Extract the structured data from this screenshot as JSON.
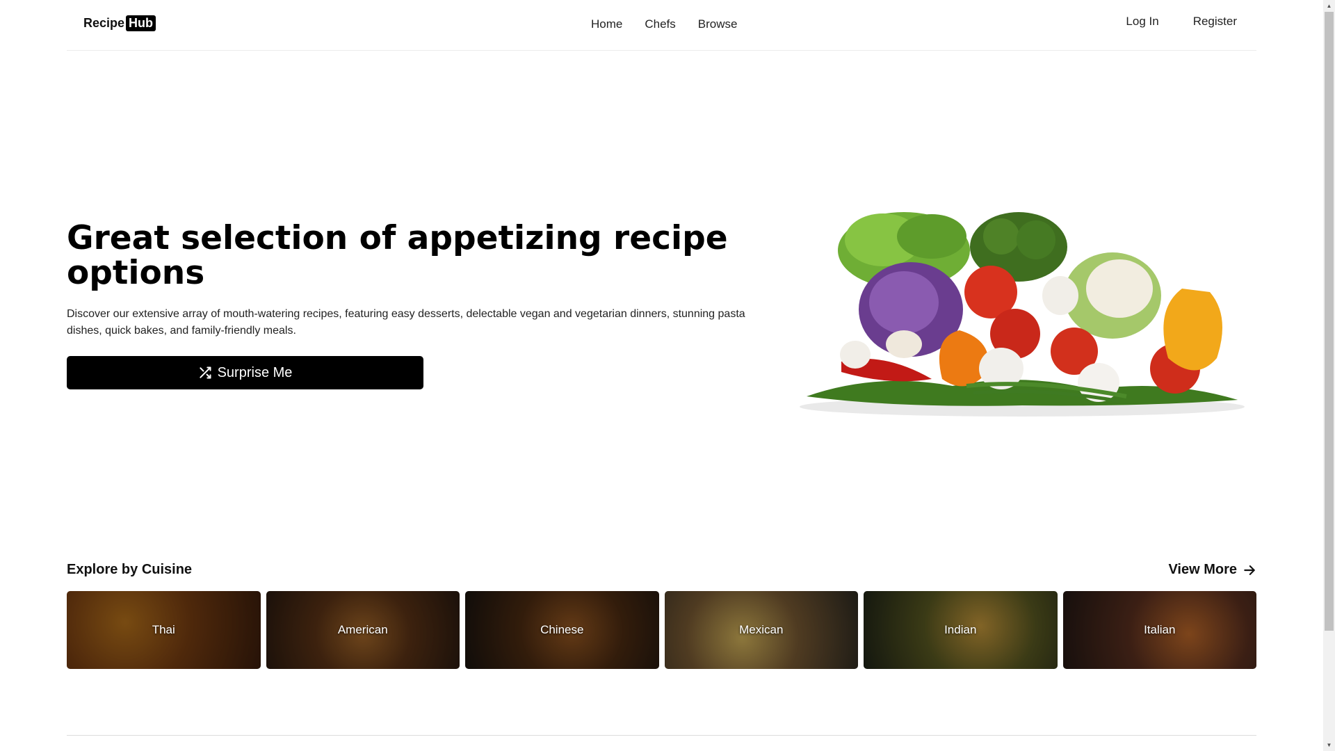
{
  "header": {
    "logo_text": "Recipe",
    "logo_badge": "Hub",
    "nav": [
      "Home",
      "Chefs",
      "Browse"
    ],
    "auth": [
      "Log In",
      "Register"
    ]
  },
  "hero": {
    "title": "Great selection of appetizing recipe options",
    "description": "Discover our extensive array of mouth-watering recipes, featuring easy desserts, delectable vegan and vegetarian dinners, stunning pasta dishes, quick bakes, and family-friendly meals.",
    "button_label": "Surprise Me",
    "button_icon": "shuffle-icon"
  },
  "cuisines": {
    "title": "Explore by Cuisine",
    "view_more": "View More",
    "items": [
      "Thai",
      "American",
      "Chinese",
      "Mexican",
      "Indian",
      "Italian"
    ]
  },
  "colors": {
    "primary": "#000000",
    "background": "#ffffff",
    "text": "#111111"
  }
}
